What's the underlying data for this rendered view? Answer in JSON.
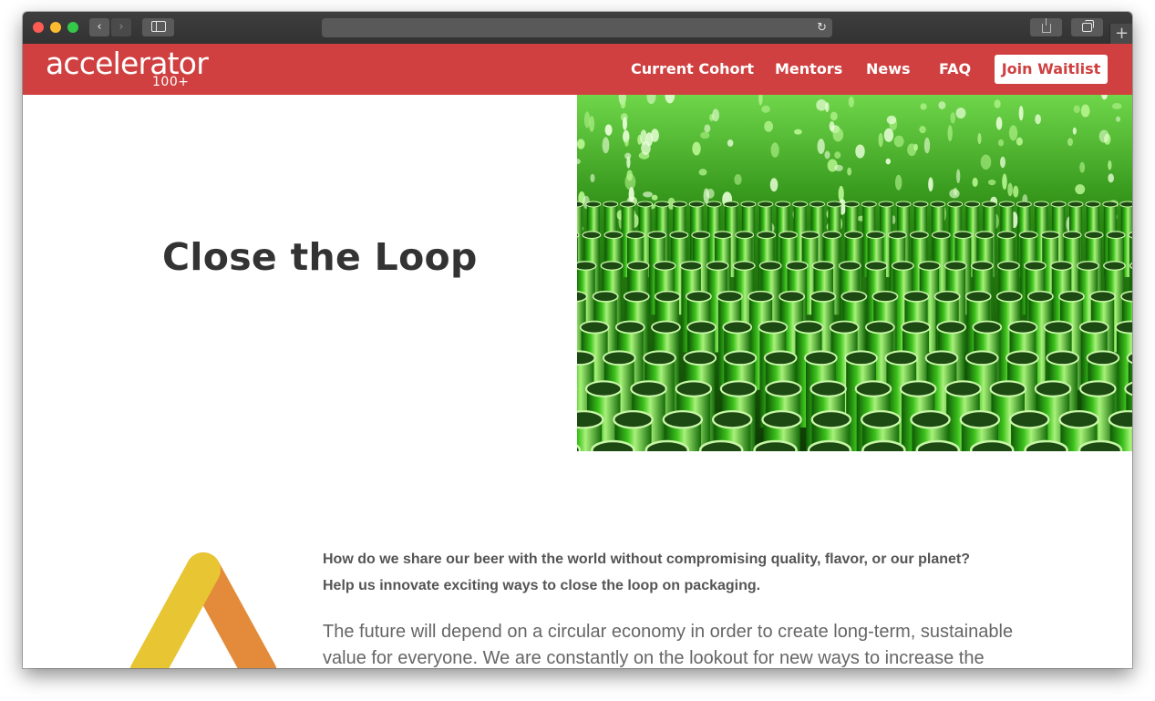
{
  "browser": {
    "back_label": "‹",
    "forward_label": "›",
    "reload_label": "↻",
    "new_tab_label": "+"
  },
  "site": {
    "logo": {
      "main": "accelerator",
      "sub": "100+"
    },
    "nav": {
      "items": [
        "Current Cohort",
        "Mentors",
        "News",
        "FAQ"
      ],
      "cta": "Join Waitlist"
    },
    "colors": {
      "brand_red": "#d04040",
      "triangle_yellow": "#e8c532",
      "triangle_orange": "#e38b3a"
    }
  },
  "hero": {
    "title": "Close the Loop",
    "image_subject": "green glass bottles"
  },
  "content": {
    "lead_lines": [
      "How do we share our beer with the world without compromising quality, flavor, or our planet?",
      "Help us innovate exciting ways to close the loop on packaging."
    ],
    "body_lines": [
      "The future will depend on a circular economy in order to create long-term, sustainable",
      "value for everyone. We are constantly on the lookout for new ways to increase the"
    ]
  }
}
